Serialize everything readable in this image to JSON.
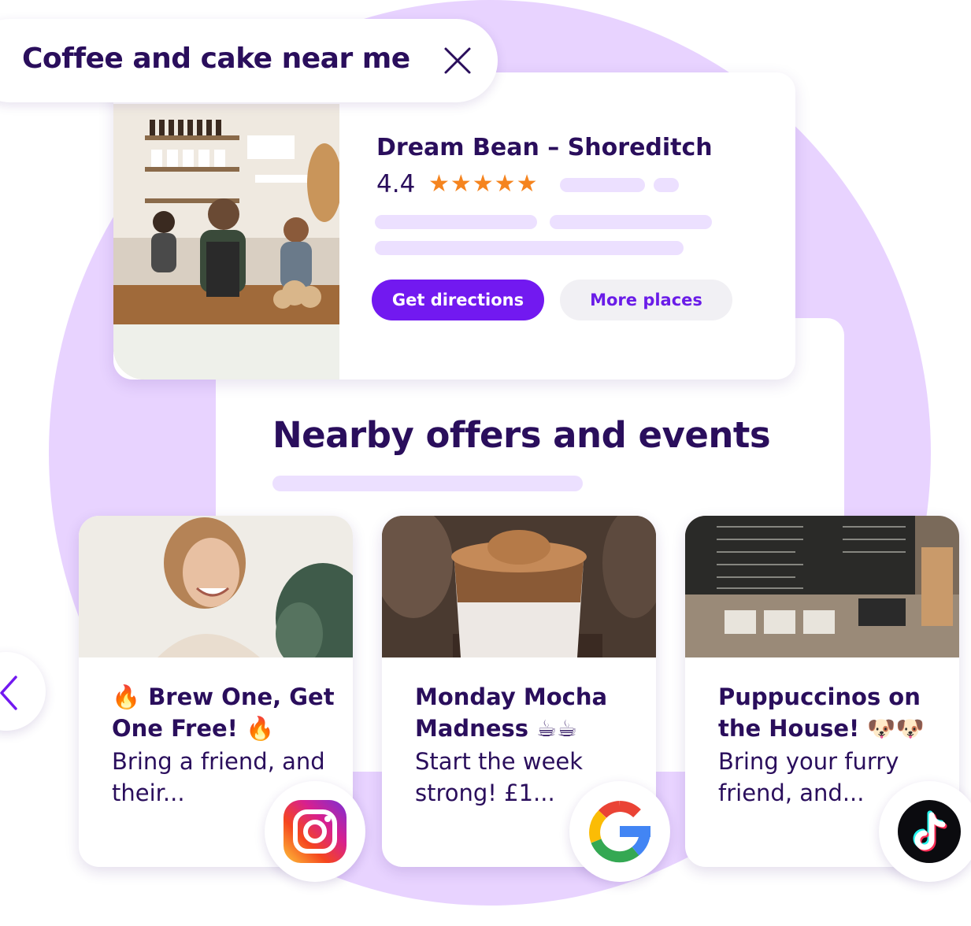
{
  "search": {
    "query": "Coffee and cake near me"
  },
  "place": {
    "name": "Dream Bean – Shoreditch",
    "rating": "4.4",
    "stars": "★★★★★",
    "directions_label": "Get directions",
    "more_label": "More places"
  },
  "events": {
    "title": "Nearby offers and events"
  },
  "offers": [
    {
      "title": "🔥 Brew One, Get One Free! 🔥",
      "description": "Bring a friend, and their...",
      "source_icon": "instagram-icon"
    },
    {
      "title": "Monday Mocha Madness ☕☕",
      "description": "Start the week strong! £1...",
      "source_icon": "google-icon"
    },
    {
      "title": "Puppuccinos on the House! 🐶🐶",
      "description": "Bring your furry friend, and...",
      "source_icon": "tiktok-icon"
    }
  ],
  "colors": {
    "accent": "#7219f0",
    "text": "#2a0e5c",
    "blob": "#e8d3ff",
    "star": "#f5841f"
  }
}
